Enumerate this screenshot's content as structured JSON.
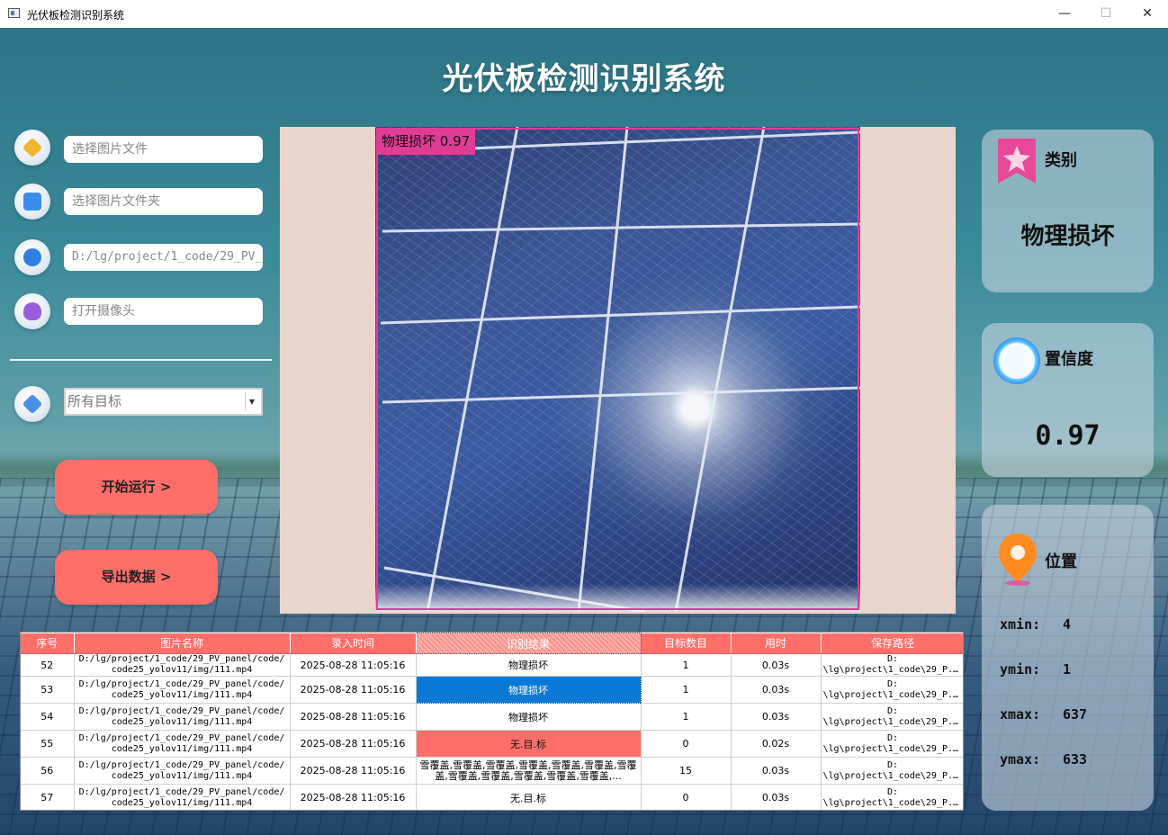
{
  "window": {
    "title": "光伏板检测识别系统",
    "controls": [
      "—",
      "☐",
      "✕"
    ]
  },
  "app_title": "光伏板检测识别系统",
  "inputs": {
    "image_file": "选择图片文件",
    "image_folder": "选择图片文件夹",
    "video_path": "D:/lg/project/1_code/29_PV_",
    "camera": "打开摄像头"
  },
  "target_select": {
    "value": "所有目标"
  },
  "buttons": {
    "start": "开始运行 >",
    "export": "导出数据 >"
  },
  "detection": {
    "label": "物理损坏 0.97"
  },
  "cards": {
    "category_title": "类别",
    "category_value": "物理损坏",
    "confidence_title": "置信度",
    "confidence_value": "0.97",
    "position_title": "位置",
    "xmin_label": "xmin:",
    "xmin": "4",
    "ymin_label": "ymin:",
    "ymin": "1",
    "xmax_label": "xmax:",
    "xmax": "637",
    "ymax_label": "ymax:",
    "ymax": "633"
  },
  "table": {
    "headers": [
      "序号",
      "图片名称",
      "录入时间",
      "识别结果",
      "目标数目",
      "用时",
      "保存路径"
    ],
    "rows": [
      {
        "id": "52",
        "name1": "D:/lg/project/1_code/29_PV_panel/code/",
        "name2": "code25_yolov11/img/111.mp4",
        "time": "2025-08-28 11:05:16",
        "result": "物理损坏",
        "count": "1",
        "cost": "0.03s",
        "path1": "D:",
        "path2": "\\lg\\project\\1_code\\29_P..."
      },
      {
        "id": "53",
        "name1": "D:/lg/project/1_code/29_PV_panel/code/",
        "name2": "code25_yolov11/img/111.mp4",
        "time": "2025-08-28 11:05:16",
        "result": "物理损坏",
        "count": "1",
        "cost": "0.03s",
        "path1": "D:",
        "path2": "\\lg\\project\\1_code\\29_P..."
      },
      {
        "id": "54",
        "name1": "D:/lg/project/1_code/29_PV_panel/code/",
        "name2": "code25_yolov11/img/111.mp4",
        "time": "2025-08-28 11:05:16",
        "result": "物理损坏",
        "count": "1",
        "cost": "0.03s",
        "path1": "D:",
        "path2": "\\lg\\project\\1_code\\29_P..."
      },
      {
        "id": "55",
        "name1": "D:/lg/project/1_code/29_PV_panel/code/",
        "name2": "code25_yolov11/img/111.mp4",
        "time": "2025-08-28 11:05:16",
        "result": "无.目.标",
        "count": "0",
        "cost": "0.02s",
        "path1": "D:",
        "path2": "\\lg\\project\\1_code\\29_P..."
      },
      {
        "id": "56",
        "name1": "D:/lg/project/1_code/29_PV_panel/code/",
        "name2": "code25_yolov11/img/111.mp4",
        "time": "2025-08-28 11:05:16",
        "result": "雪覆盖,雪覆盖,雪覆盖,雪覆盖,雪覆盖,雪覆盖,雪覆盖,雪覆盖,雪覆盖,雪覆盖,雪覆盖,雪覆盖,...",
        "count": "15",
        "cost": "0.03s",
        "path1": "D:",
        "path2": "\\lg\\project\\1_code\\29_P..."
      },
      {
        "id": "57",
        "name1": "D:/lg/project/1_code/29_PV_panel/code/",
        "name2": "code25_yolov11/img/111.mp4",
        "time": "2025-08-28 11:05:16",
        "result": "无.目.标",
        "count": "0",
        "cost": "0.03s",
        "path1": "D:",
        "path2": "\\lg\\project\\1_code\\29_P..."
      }
    ]
  }
}
